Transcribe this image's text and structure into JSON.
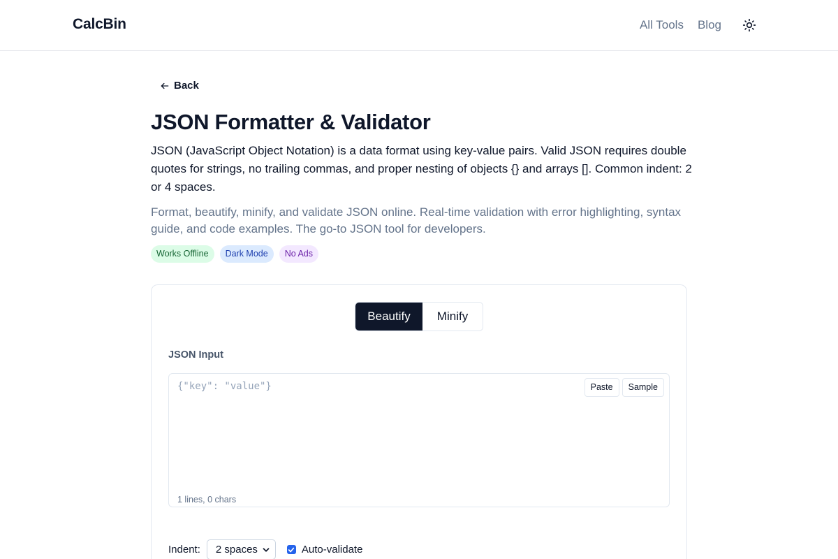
{
  "header": {
    "brand": "CalcBin",
    "nav": [
      "All Tools",
      "Blog"
    ],
    "theme_icon": "sun-icon"
  },
  "page": {
    "back_label": "Back",
    "title": "JSON Formatter & Validator",
    "description": "JSON (JavaScript Object Notation) is a data format using key-value pairs. Valid JSON requires double quotes for strings, no trailing commas, and proper nesting of objects {} and arrays []. Common indent: 2 or 4 spaces.",
    "subdescription": "Format, beautify, minify, and validate JSON online. Real-time validation with error highlighting, syntax guide, and code examples. The go-to JSON tool for developers.",
    "badges": [
      "Works Offline",
      "Dark Mode",
      "No Ads"
    ]
  },
  "tool": {
    "tabs": [
      "Beautify",
      "Minify"
    ],
    "active_tab": "Beautify",
    "input_label": "JSON Input",
    "input_value": "",
    "input_placeholder": "{\"key\": \"value\"}",
    "paste_label": "Paste",
    "sample_label": "Sample",
    "stats": "1 lines, 0 chars",
    "indent_label": "Indent:",
    "indent_value": "2 spaces",
    "auto_validate_label": "Auto-validate",
    "auto_validate_checked": true
  },
  "colors": {
    "primary": "#0f172a",
    "muted": "#64748b",
    "checkbox": "#2563eb"
  }
}
